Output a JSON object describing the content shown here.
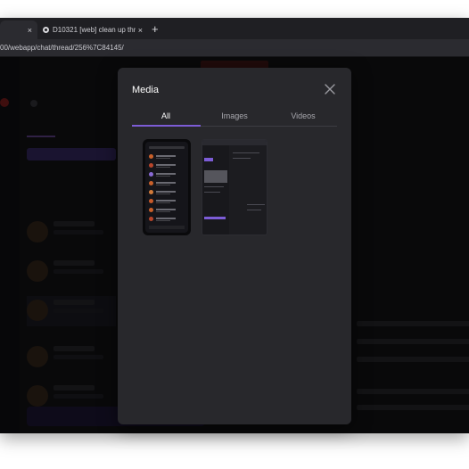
{
  "browser": {
    "tabs": [
      {
        "label": "",
        "active": true
      },
      {
        "label": "D10321 [web] clean up thr",
        "active": false
      }
    ],
    "tab_close_glyph": "×",
    "new_tab_glyph": "+",
    "url": "00/webapp/chat/thread/256%7C84145/"
  },
  "modal": {
    "title": "Media",
    "close_icon": "close-icon",
    "tabs": [
      {
        "label": "All",
        "active": true
      },
      {
        "label": "Images",
        "active": false
      },
      {
        "label": "Videos",
        "active": false
      }
    ],
    "accent_color": "#7c5cd6",
    "items": [
      {
        "kind": "phone-screenshot"
      },
      {
        "kind": "desktop-screenshot"
      }
    ]
  },
  "colors": {
    "modal_bg": "#28282c",
    "page_bg": "#0e0e12",
    "accent": "#7c5cd6"
  }
}
